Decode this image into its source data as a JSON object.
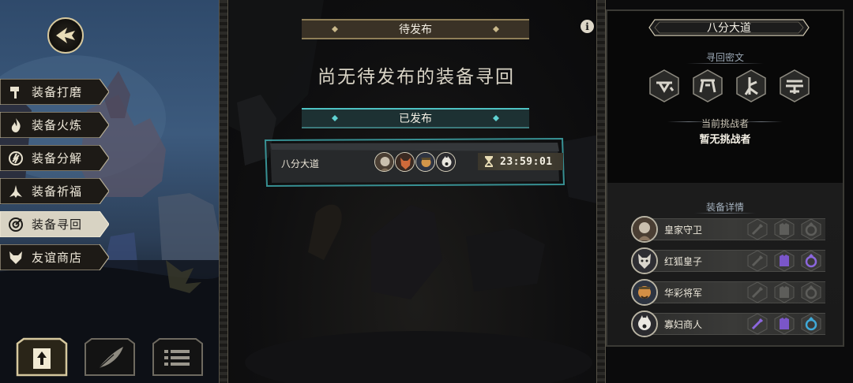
{
  "left_menu": {
    "items": [
      {
        "label": "装备打磨",
        "icon": "hammer-icon"
      },
      {
        "label": "装备火炼",
        "icon": "flame-icon"
      },
      {
        "label": "装备分解",
        "icon": "dismantle-icon"
      },
      {
        "label": "装备祈福",
        "icon": "pray-icon"
      },
      {
        "label": "装备寻回",
        "icon": "target-icon",
        "active": true
      },
      {
        "label": "友谊商店",
        "icon": "fox-icon"
      }
    ],
    "bottom_buttons": [
      "upload-icon",
      "feather-icon",
      "list-icon"
    ]
  },
  "middle": {
    "pending_banner": "待发布",
    "empty_message": "尚无待发布的装备寻回",
    "published_banner": "已发布",
    "published_entry": {
      "name": "八分大道",
      "timer": "23:59:01"
    }
  },
  "right": {
    "title": "八分大道",
    "runes_label": "寻回密文",
    "challenger_label": "当前挑战者",
    "challenger_value": "暂无挑战者",
    "equip_label": "装备详情",
    "equipment": [
      {
        "name": "皇家守卫",
        "slots": [
          "empty",
          "empty",
          "empty"
        ]
      },
      {
        "name": "红狐皇子",
        "slots": [
          "empty",
          "filled",
          "filled"
        ]
      },
      {
        "name": "华彩将军",
        "slots": [
          "empty",
          "empty",
          "empty"
        ]
      },
      {
        "name": "寡妇商人",
        "slots": [
          "filled",
          "filled",
          "filled"
        ]
      }
    ]
  },
  "colors": {
    "accent_gold": "#d6c89e",
    "teal": "#4ec3c4",
    "purple": "#7a56c9",
    "rune_gray": "#c9c6bc"
  }
}
